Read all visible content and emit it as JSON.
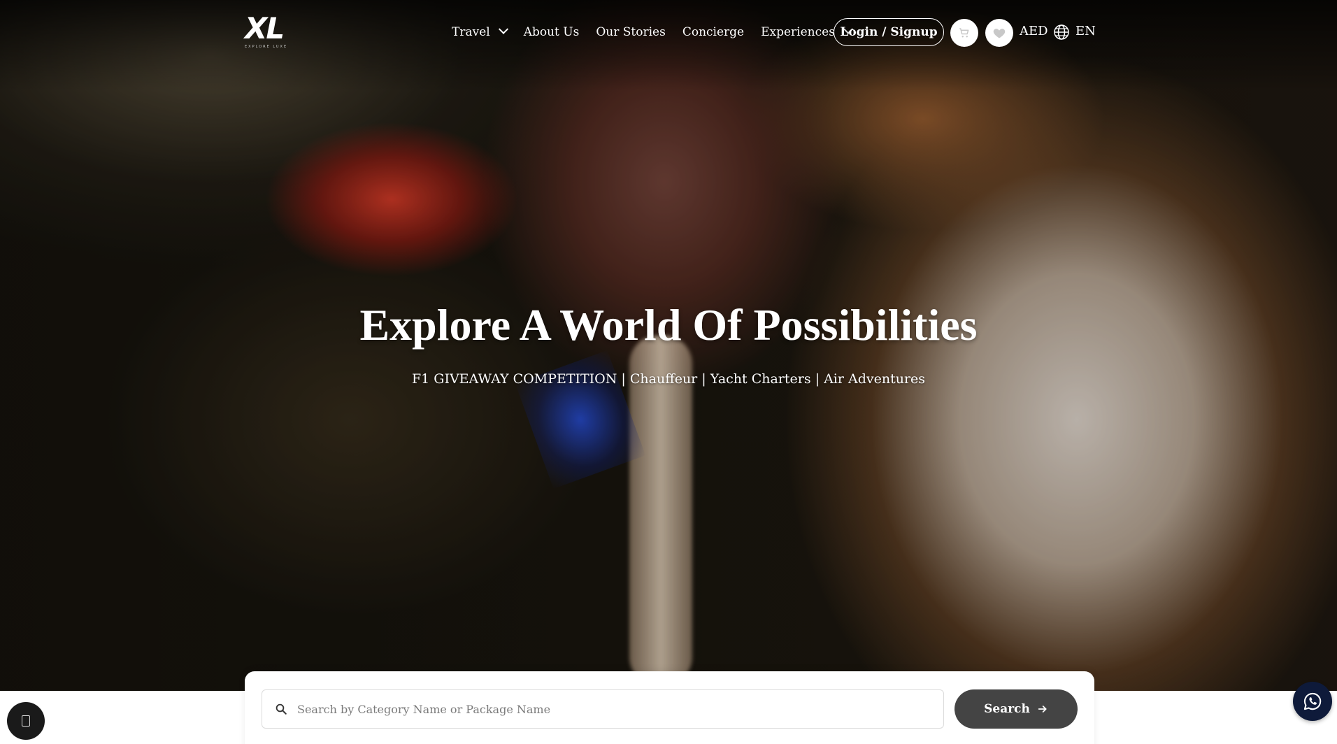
{
  "brand": {
    "logo_text": "XL",
    "logo_subtext": "EXPLORE LUXE"
  },
  "nav": {
    "items": [
      {
        "label": "Travel",
        "has_dropdown": true
      },
      {
        "label": "About Us",
        "has_dropdown": false
      },
      {
        "label": "Our Stories",
        "has_dropdown": false
      },
      {
        "label": "Concierge",
        "has_dropdown": false
      },
      {
        "label": "Experiences",
        "has_dropdown": true
      }
    ],
    "login_label": "Login / Signup",
    "cart_icon": "cart-icon",
    "wishlist_icon": "heart-icon",
    "currency": "AED",
    "language_icon": "globe-icon",
    "language": "EN"
  },
  "hero": {
    "title": "Explore A World Of Possibilities",
    "subtitle": "F1 GIVEAWAY COMPETITION | Chauffeur | Yacht Charters | Air Adventures"
  },
  "search": {
    "placeholder": "Search by Category Name or Package Name",
    "value": "",
    "button_label": "Search",
    "search_icon": "search-icon",
    "button_icon": "arrow-right-icon"
  },
  "widgets": {
    "chat_icon": "chat-icon",
    "whatsapp_icon": "whatsapp-icon"
  },
  "colors": {
    "search_button": "#444444",
    "whatsapp_button": "#0e1a3a",
    "text_on_hero": "#ffffff"
  }
}
